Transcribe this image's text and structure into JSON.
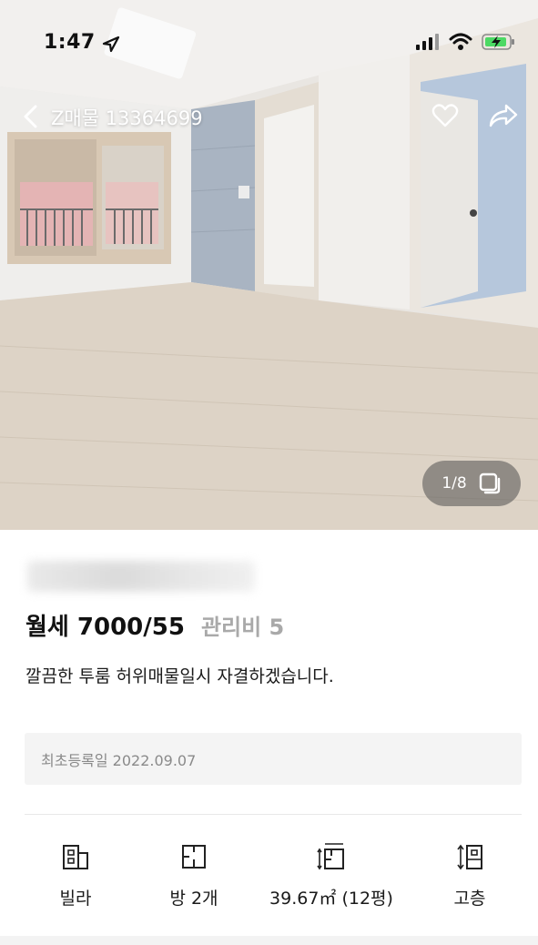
{
  "status_bar": {
    "time": "1:47"
  },
  "nav": {
    "title": "Z매물 13364699"
  },
  "gallery": {
    "counter": "1/8"
  },
  "listing": {
    "price": "월세 7000/55",
    "maintenance_fee": "관리비 5",
    "description": "깔끔한 투룸 허위매물일시 자결하겠습니다.",
    "registration": "최초등록일 2022.09.07"
  },
  "features": [
    {
      "icon": "building-icon",
      "label": "빌라"
    },
    {
      "icon": "room-icon",
      "label": "방 2개"
    },
    {
      "icon": "area-icon",
      "label": "39.67㎡ (12평)"
    },
    {
      "icon": "floor-height-icon",
      "label": "고층"
    }
  ],
  "colors": {
    "accent_battery": "#4cd964",
    "fee_gray": "#a9a9a9"
  }
}
